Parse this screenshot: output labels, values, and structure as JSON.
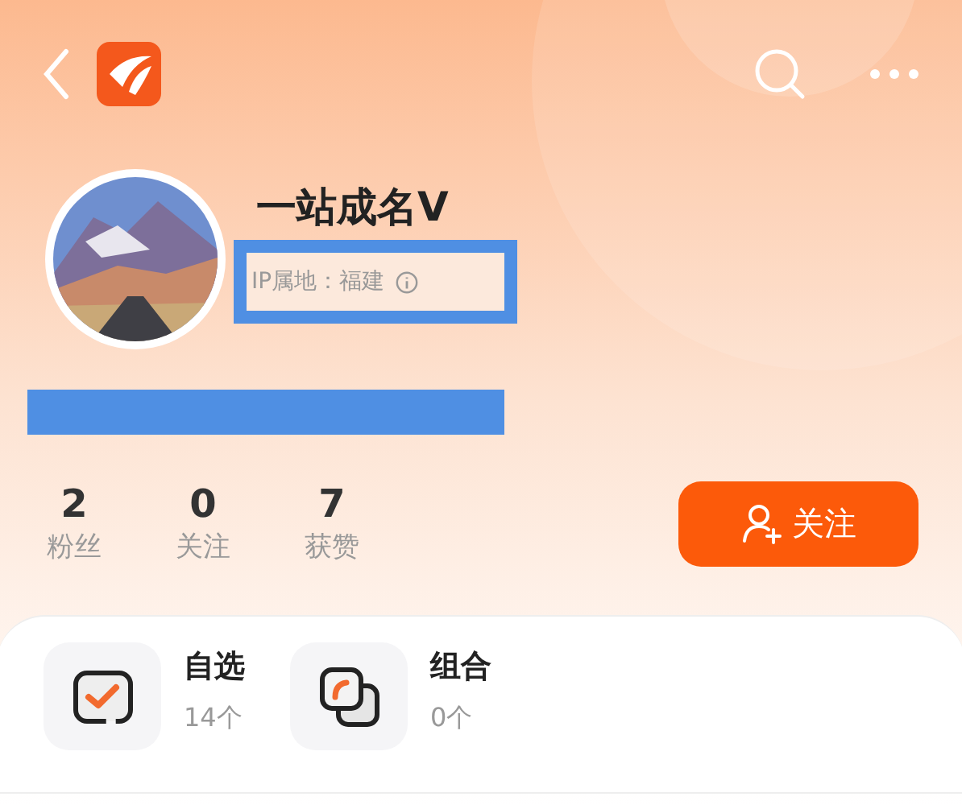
{
  "profile": {
    "name": "一站成名V",
    "ip_location": "IP属地：福建"
  },
  "stats": [
    {
      "value": "2",
      "label": "粉丝"
    },
    {
      "value": "0",
      "label": "关注"
    },
    {
      "value": "7",
      "label": "获赞"
    }
  ],
  "follow_button": {
    "label": "关注"
  },
  "shortcuts": [
    {
      "kind": "watchlist",
      "title": "自选",
      "count": "14个"
    },
    {
      "kind": "portfolio",
      "title": "组合",
      "count": "0个"
    }
  ]
}
